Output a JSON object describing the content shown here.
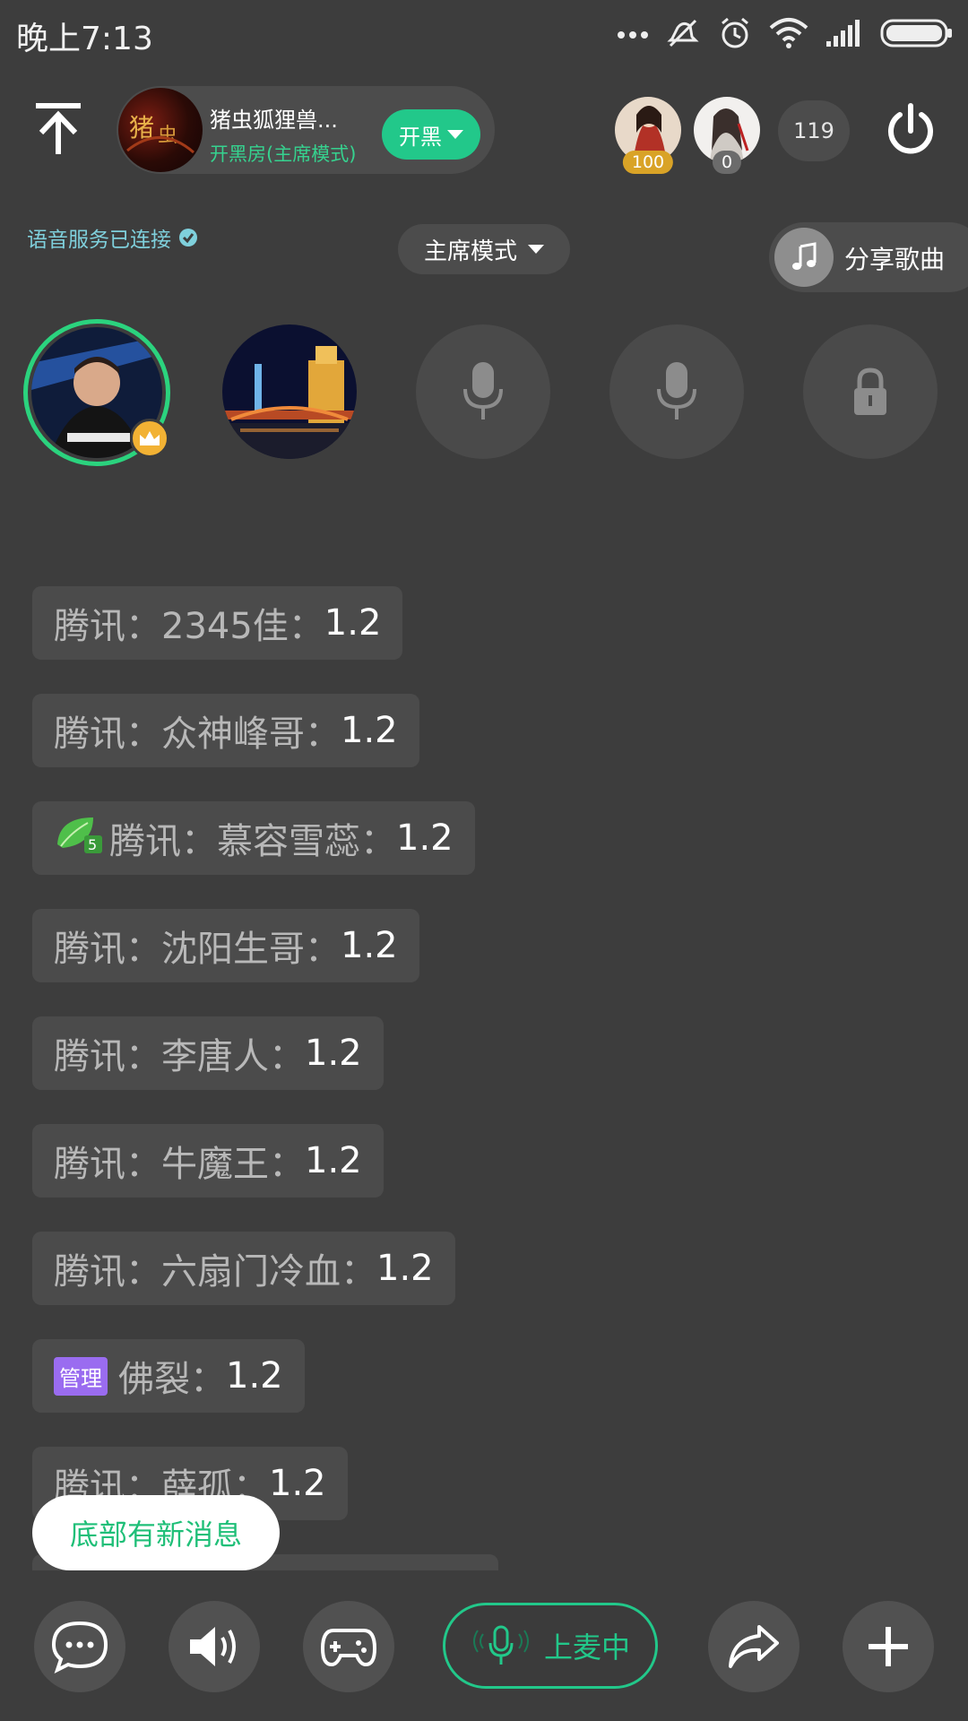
{
  "status_bar": {
    "time": "晚上7:13",
    "icons": [
      "more-dots-icon",
      "mute-vibrate-icon",
      "alarm-icon",
      "wifi-icon",
      "signal-icon",
      "battery-icon"
    ]
  },
  "header": {
    "room_name": "猪虫狐狸兽...",
    "room_mode": "开黑房(主席模式)",
    "kaihei_label": "开黑",
    "viewers": [
      {
        "badge": "100",
        "badge_color": "#d9a327"
      },
      {
        "badge": "0",
        "badge_color": "#6b6b6b"
      }
    ],
    "online_count": "119"
  },
  "voice_status": "语音服务已连接",
  "mode_select": "主席模式",
  "share_song": "分享歌曲",
  "seats": [
    {
      "type": "host"
    },
    {
      "type": "user"
    },
    {
      "type": "empty-mic"
    },
    {
      "type": "empty-mic"
    },
    {
      "type": "locked"
    }
  ],
  "messages": [
    {
      "prefix": "",
      "who": "腾讯：2345佳：",
      "value": "1.2"
    },
    {
      "prefix": "",
      "who": "腾讯：众神峰哥：",
      "value": "1.2"
    },
    {
      "prefix": "leaf-5",
      "level": "5",
      "who": "腾讯：慕容雪蕊：",
      "value": "1.2"
    },
    {
      "prefix": "",
      "who": "腾讯：沈阳生哥：",
      "value": "1.2"
    },
    {
      "prefix": "",
      "who": "腾讯：李唐人：",
      "value": "1.2"
    },
    {
      "prefix": "",
      "who": "腾讯：牛魔王：",
      "value": "1.2"
    },
    {
      "prefix": "",
      "who": "腾讯：六扇门冷血：",
      "value": "1.2"
    },
    {
      "prefix": "admin",
      "tag": "管理",
      "who": "佛裂：",
      "value": "1.2"
    },
    {
      "prefix": "",
      "who": "腾讯：薛孤：",
      "value": "1.2"
    }
  ],
  "new_message_notice": "底部有新消息",
  "bottom_bar": {
    "mic_label": "上麦中"
  },
  "colors": {
    "accent_green": "#22c88a",
    "admin_purple": "#9a6cf0",
    "background": "#3d3d3d"
  }
}
